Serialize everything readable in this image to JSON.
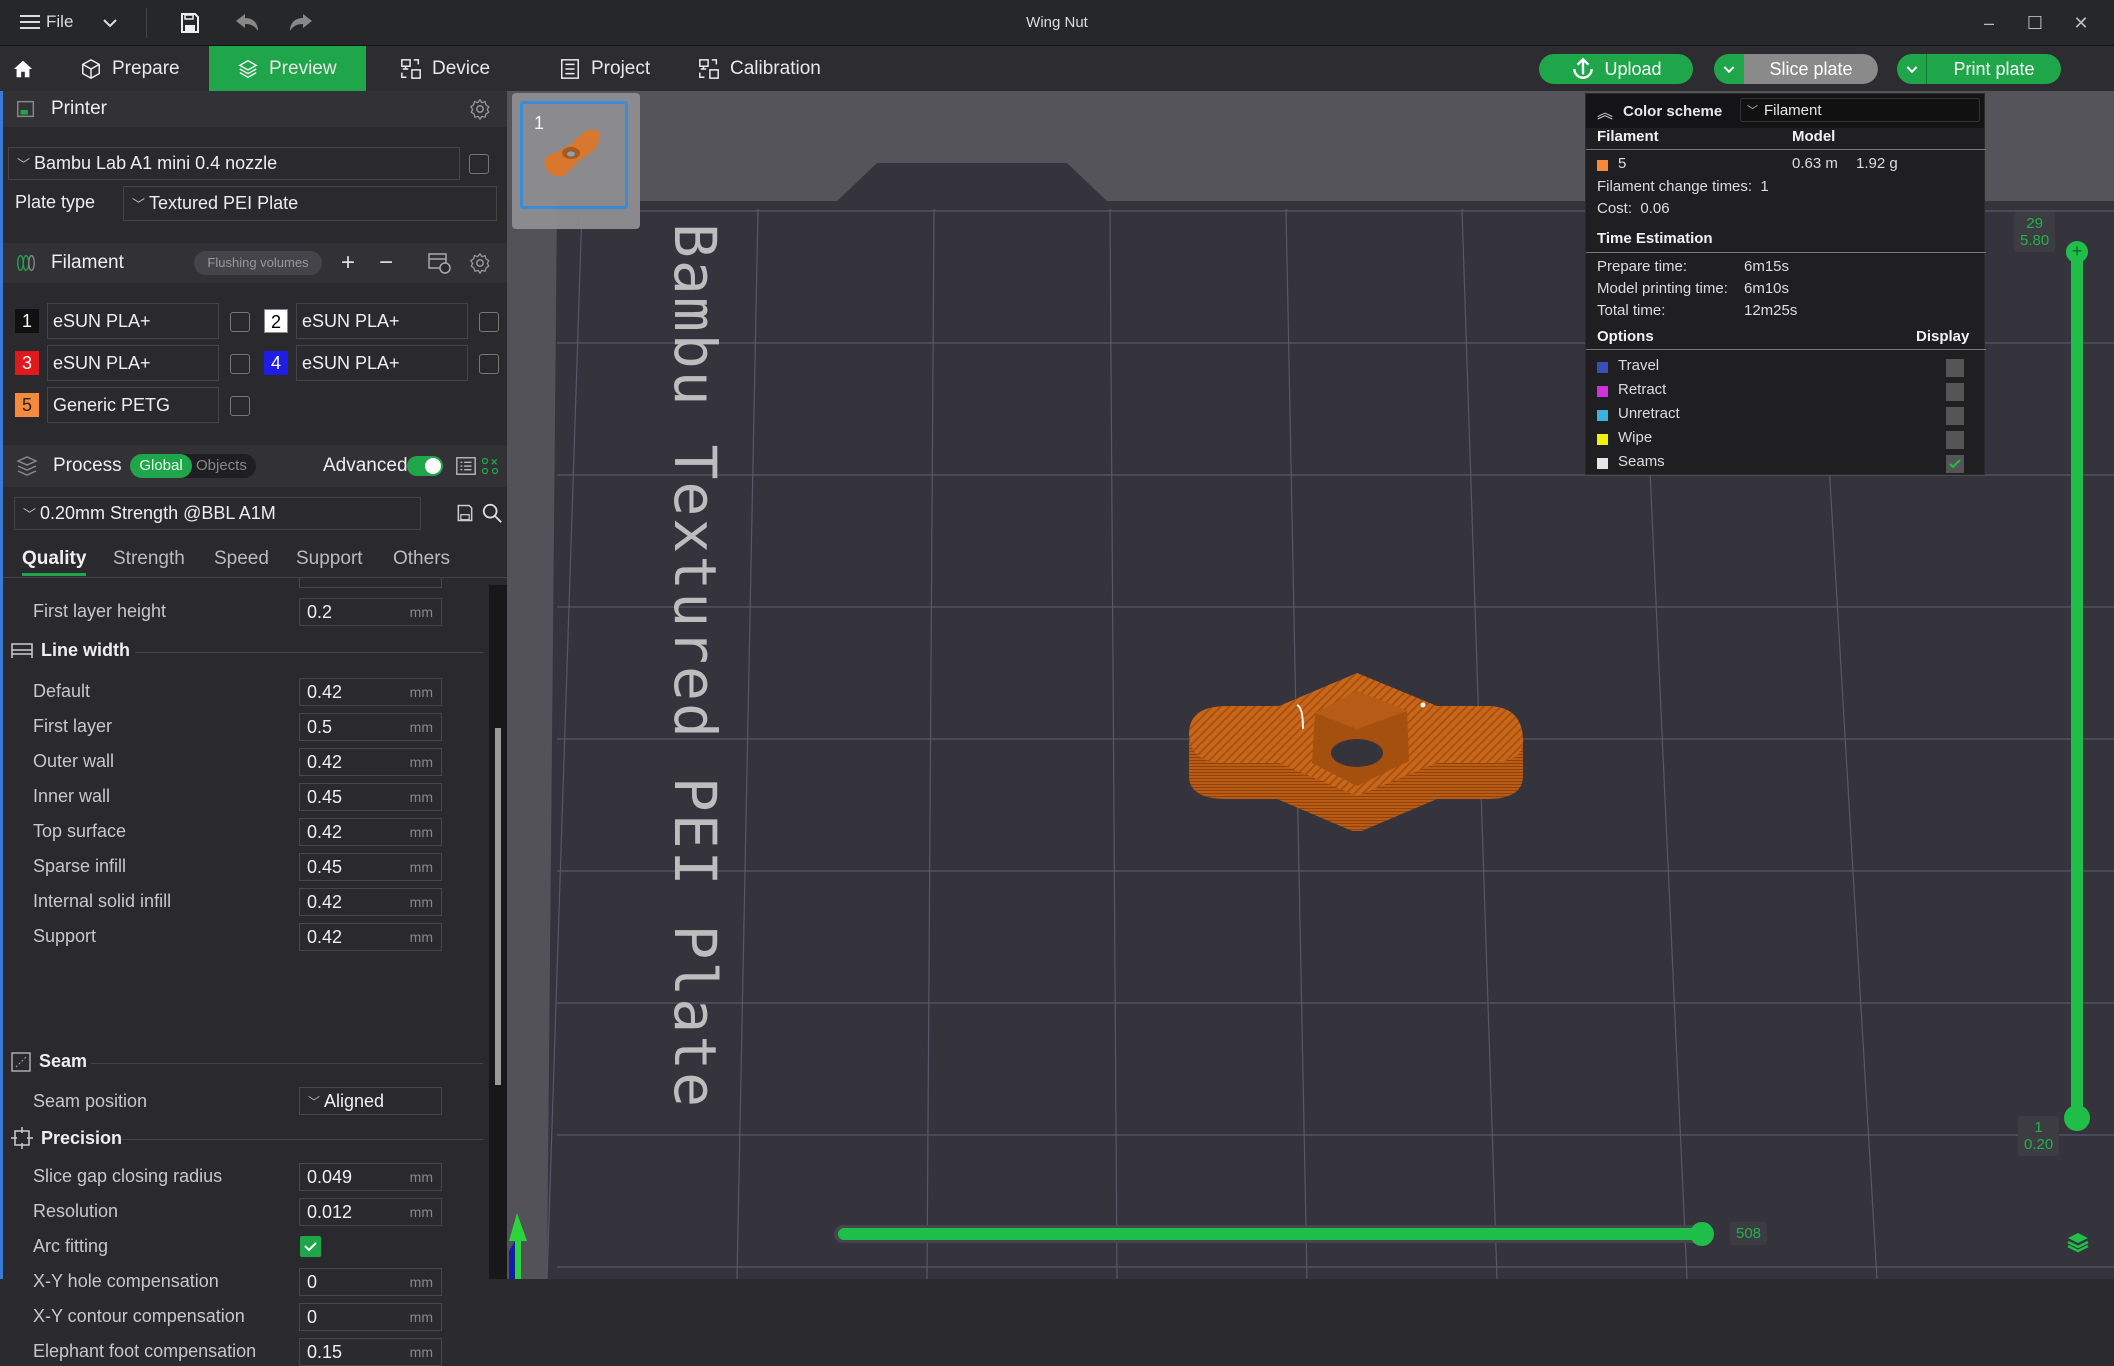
{
  "window": {
    "title": "Wing Nut",
    "menu_label": "File",
    "controls": {
      "minimize": "–",
      "maximize": "☐",
      "close": "✕"
    }
  },
  "icons": {
    "menu": "hamburger-icon",
    "dropdown": "chevron-down-icon",
    "save": "save-icon",
    "undo": "undo-icon",
    "redo": "redo-icon",
    "home": "home-icon"
  },
  "tabs": [
    {
      "label": "Prepare",
      "icon": "cube-icon",
      "active": false
    },
    {
      "label": "Preview",
      "icon": "layers-icon",
      "active": true
    },
    {
      "label": "Device",
      "icon": "device-icon",
      "active": false
    },
    {
      "label": "Project",
      "icon": "list-icon",
      "active": false
    },
    {
      "label": "Calibration",
      "icon": "calibration-icon",
      "active": false
    }
  ],
  "actions": {
    "upload": "Upload",
    "slice": "Slice plate",
    "print": "Print plate"
  },
  "printer": {
    "title": "Printer",
    "preset": "Bambu Lab A1 mini 0.4 nozzle",
    "plate_type_label": "Plate type",
    "plate_type": "Textured PEI Plate"
  },
  "filament": {
    "title": "Filament",
    "flushing_label": "Flushing volumes",
    "slots": [
      {
        "num": "1",
        "name": "eSUN PLA+",
        "color": "#111111",
        "text_color": "#ffffff"
      },
      {
        "num": "2",
        "name": "eSUN PLA+",
        "color": "#ffffff",
        "text_color": "#000000"
      },
      {
        "num": "3",
        "name": "eSUN PLA+",
        "color": "#e0191d",
        "text_color": "#ffffff"
      },
      {
        "num": "4",
        "name": "eSUN PLA+",
        "color": "#1e1ee6",
        "text_color": "#ffffff"
      },
      {
        "num": "5",
        "name": "Generic PETG",
        "color": "#f58a3a",
        "text_color": "#222222"
      }
    ]
  },
  "process": {
    "title": "Process",
    "global_label": "Global",
    "objects_label": "Objects",
    "advanced_label": "Advanced",
    "advanced_on": true,
    "preset": "0.20mm Strength @BBL A1M",
    "tabs": [
      "Quality",
      "Strength",
      "Speed",
      "Support",
      "Others"
    ],
    "active_tab": "Quality",
    "first_layer_height": {
      "label": "First layer height",
      "value": "0.2",
      "unit": "mm"
    },
    "line_width": {
      "title": "Line width",
      "rows": [
        {
          "label": "Default",
          "value": "0.42",
          "unit": "mm"
        },
        {
          "label": "First layer",
          "value": "0.5",
          "unit": "mm"
        },
        {
          "label": "Outer wall",
          "value": "0.42",
          "unit": "mm"
        },
        {
          "label": "Inner wall",
          "value": "0.45",
          "unit": "mm"
        },
        {
          "label": "Top surface",
          "value": "0.42",
          "unit": "mm"
        },
        {
          "label": "Sparse infill",
          "value": "0.45",
          "unit": "mm"
        },
        {
          "label": "Internal solid infill",
          "value": "0.42",
          "unit": "mm"
        },
        {
          "label": "Support",
          "value": "0.42",
          "unit": "mm"
        }
      ]
    },
    "seam": {
      "title": "Seam",
      "position_label": "Seam position",
      "position_value": "Aligned"
    },
    "precision": {
      "title": "Precision",
      "slice_gap": {
        "label": "Slice gap closing radius",
        "value": "0.049",
        "unit": "mm"
      },
      "resolution": {
        "label": "Resolution",
        "value": "0.012",
        "unit": "mm"
      },
      "arc_fitting": {
        "label": "Arc fitting",
        "checked": true
      },
      "xy_hole": {
        "label": "X-Y hole compensation",
        "value": "0",
        "unit": "mm"
      },
      "xy_contour": {
        "label": "X-Y contour compensation",
        "value": "0",
        "unit": "mm"
      },
      "elephant_foot": {
        "label": "Elephant foot compensation",
        "value": "0.15",
        "unit": "mm"
      }
    }
  },
  "plate": {
    "thumbnail_number": "1",
    "bed_label": "Bambu Textured PEI Plate"
  },
  "legend": {
    "color_scheme_label": "Color scheme",
    "color_scheme_value": "Filament",
    "filament_header": "Filament",
    "model_header": "Model",
    "filament_id": "5",
    "filament_color": "#f58a3a",
    "length": "0.63 m",
    "weight": "1.92 g",
    "change_times_label": "Filament change times:",
    "change_times": "1",
    "cost_label": "Cost:",
    "cost": "0.06",
    "time_title": "Time Estimation",
    "prepare_label": "Prepare time:",
    "prepare_time": "6m15s",
    "model_time_label": "Model printing time:",
    "model_time": "6m10s",
    "total_label": "Total time:",
    "total_time": "12m25s",
    "options_header": "Options",
    "display_header": "Display",
    "options": [
      {
        "label": "Travel",
        "color": "#3a4fb5",
        "checked": false
      },
      {
        "label": "Retract",
        "color": "#d230d9",
        "checked": false
      },
      {
        "label": "Unretract",
        "color": "#3bb2dc",
        "checked": false
      },
      {
        "label": "Wipe",
        "color": "#f1f10d",
        "checked": false
      },
      {
        "label": "Seams",
        "color": "#e6e6e6",
        "checked": true
      }
    ]
  },
  "layer_slider": {
    "top_layer": "29",
    "top_height": "5.80",
    "bottom_layer": "1",
    "bottom_height": "0.20"
  },
  "move_slider": {
    "value": "508",
    "fraction": 1.0
  },
  "colors": {
    "accent": "#1fa54a",
    "model": "#c8661a"
  }
}
